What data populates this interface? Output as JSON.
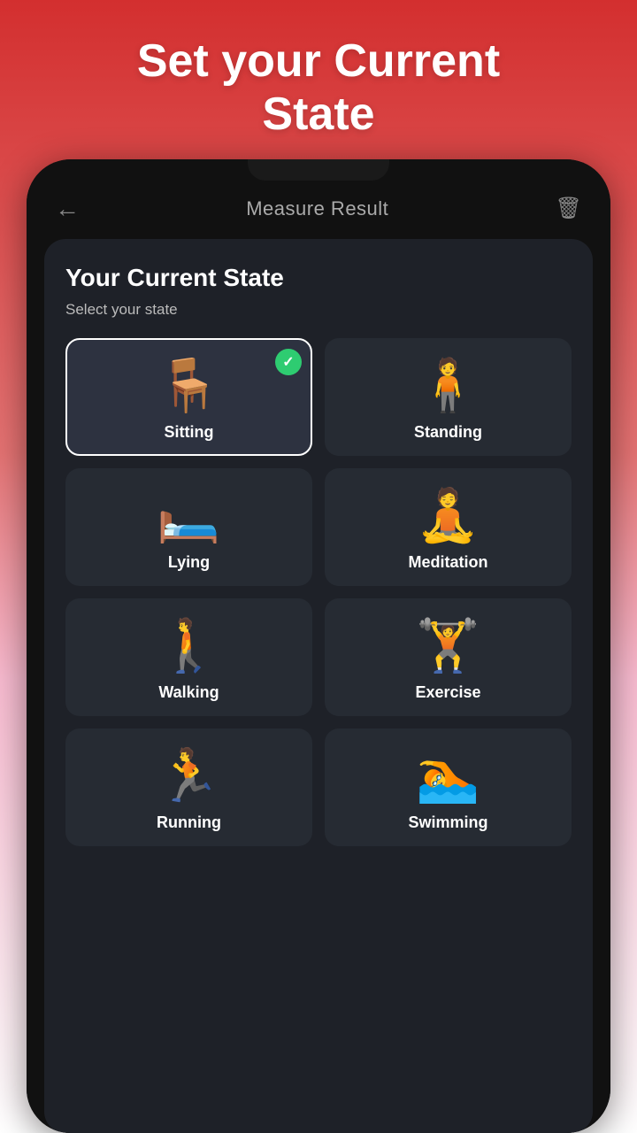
{
  "appTitle": "Set your Current\nState",
  "header": {
    "backLabel": "←",
    "title": "Measure Result",
    "deleteLabel": "🗑"
  },
  "card": {
    "title": "Your Current State",
    "subtitle": "Select your state",
    "states": [
      {
        "id": "sitting",
        "label": "Sitting",
        "icon": "🪑",
        "selected": true
      },
      {
        "id": "standing",
        "label": "Standing",
        "icon": "🧍",
        "selected": false
      },
      {
        "id": "lying",
        "label": "Lying",
        "icon": "🛏️",
        "selected": false
      },
      {
        "id": "meditation",
        "label": "Meditation",
        "icon": "🧘",
        "selected": false
      },
      {
        "id": "walking",
        "label": "Walking",
        "icon": "🚶",
        "selected": false
      },
      {
        "id": "exercise",
        "label": "Exercise",
        "icon": "🏋️",
        "selected": false
      },
      {
        "id": "running",
        "label": "Running",
        "icon": "🏃",
        "selected": false
      },
      {
        "id": "swimming",
        "label": "Swimming",
        "icon": "🏊",
        "selected": false
      }
    ]
  }
}
